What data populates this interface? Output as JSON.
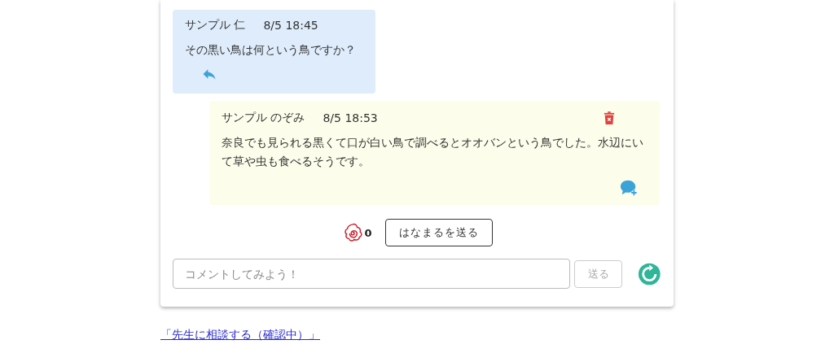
{
  "messages": [
    {
      "kind": "received",
      "author": "サンプル 仁",
      "time": "8/5 18:45",
      "text": "その黒い鳥は何という鳥ですか？"
    },
    {
      "kind": "sent",
      "author": "サンプル のぞみ",
      "time": "8/5 18:53",
      "text": "奈良でも見られる黒くて口が白い鳥で調べるとオオバンという鳥でした。水辺にいて草や虫も食べるそうです。"
    }
  ],
  "hanamaru": {
    "count": "0",
    "button": "はなまるを送る"
  },
  "comment": {
    "placeholder": "コメントしてみよう！",
    "send_button": "送る",
    "send_disabled": true
  },
  "consult_link": "「先生に相談する（確認中）」"
}
